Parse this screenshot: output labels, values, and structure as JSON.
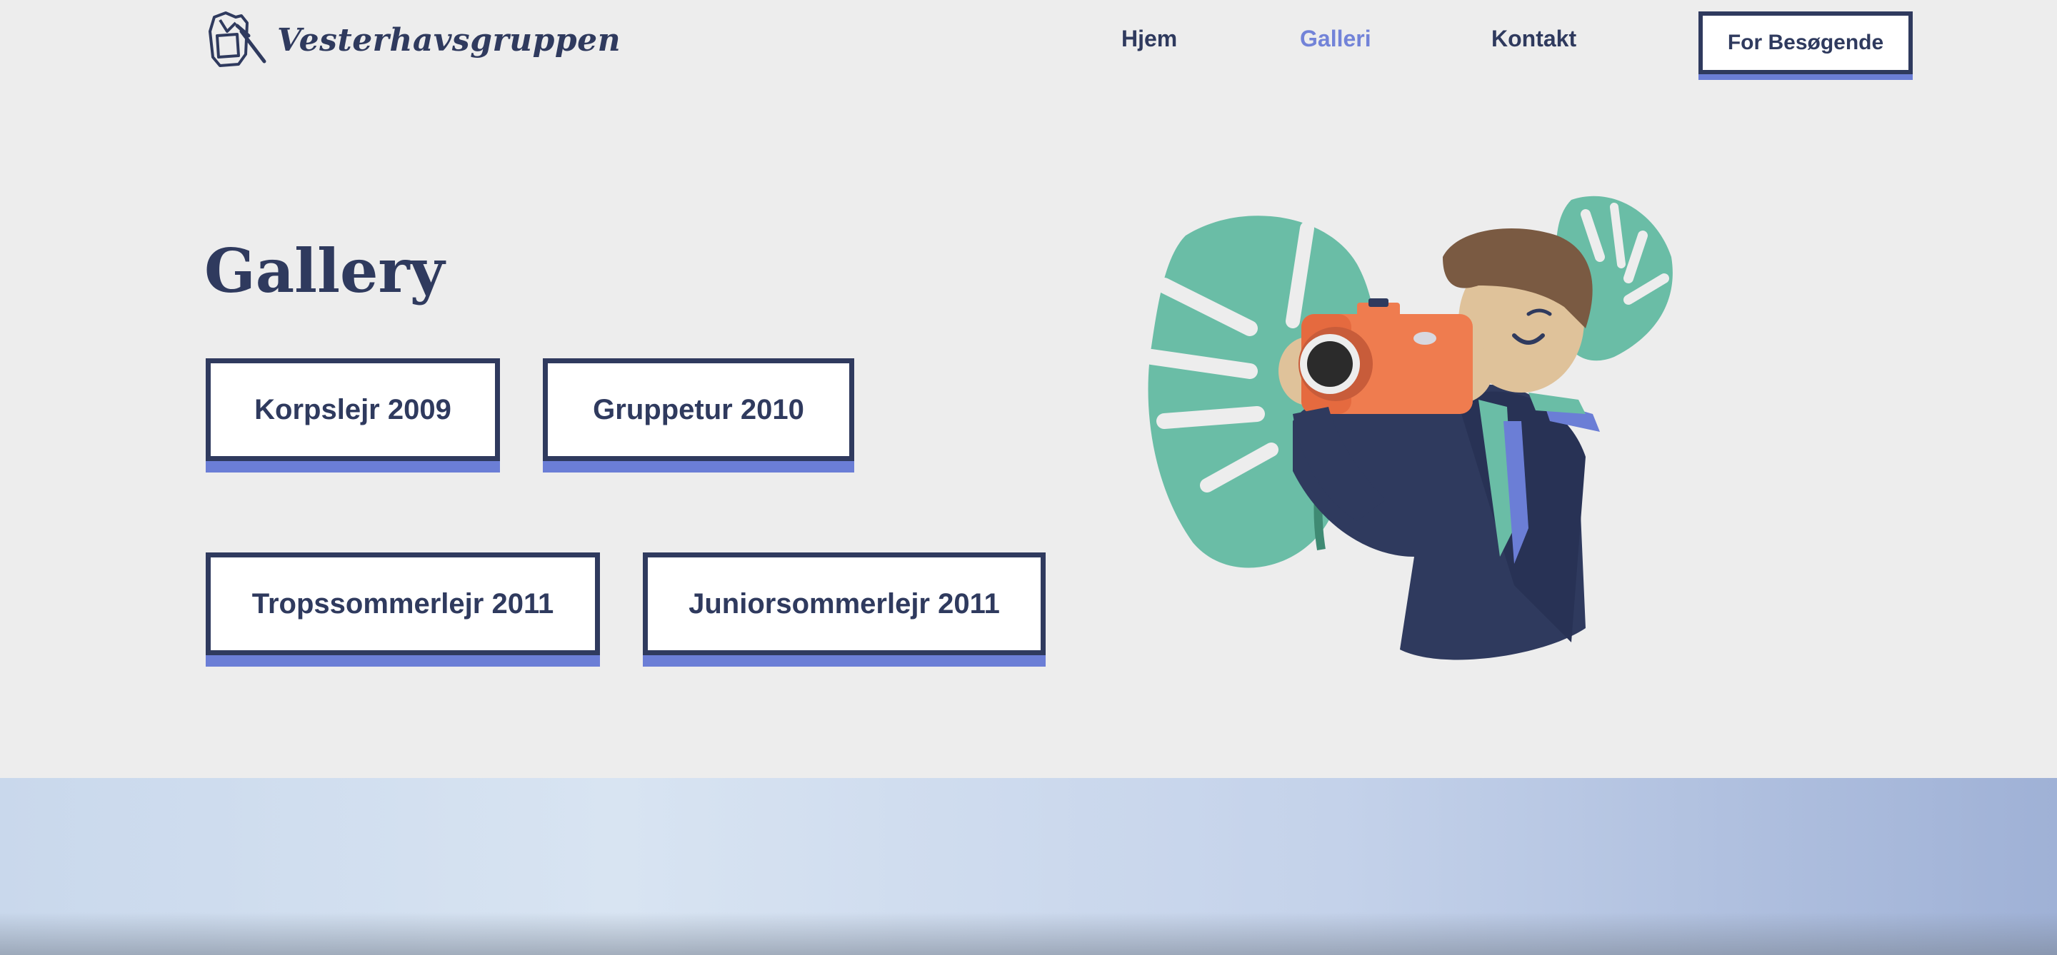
{
  "brand": {
    "name": "Vesterhavsgruppen",
    "logo_icon": "scout-backpack-icon"
  },
  "nav": {
    "items": [
      {
        "label": "Hjem",
        "active": false
      },
      {
        "label": "Galleri",
        "active": true
      },
      {
        "label": "Kontakt",
        "active": false
      }
    ],
    "cta_label": "For Besøgende"
  },
  "main": {
    "title": "Gallery",
    "galleries": [
      {
        "label": "Korpslejr 2009"
      },
      {
        "label": "Gruppetur 2010"
      },
      {
        "label": "Tropssommerlejr 2011"
      },
      {
        "label": "Juniorsommerlejr 2011"
      }
    ],
    "illustration": "scout-with-camera-illustration"
  },
  "colors": {
    "navy": "#2f3a5e",
    "accent": "#6b7ed6",
    "active_link": "#7283d8",
    "background": "#ededed",
    "leaf": "#6abda6",
    "camera": "#ef7c4f"
  }
}
